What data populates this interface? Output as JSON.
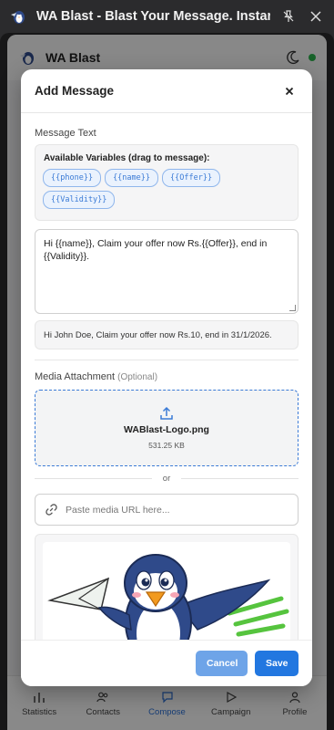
{
  "window": {
    "title": "WA Blast - Blast Your Message. Instan"
  },
  "app": {
    "name": "WA Blast",
    "status_color": "#2bb24c",
    "nav": [
      {
        "label": "Statistics",
        "icon": "bar-chart-icon"
      },
      {
        "label": "Contacts",
        "icon": "users-icon"
      },
      {
        "label": "Compose",
        "icon": "compose-icon",
        "active": true
      },
      {
        "label": "Campaign",
        "icon": "send-icon"
      },
      {
        "label": "Profile",
        "icon": "user-icon"
      }
    ]
  },
  "modal": {
    "title": "Add Message",
    "message_label": "Message Text",
    "variables_title": "Available Variables (drag to message):",
    "variables": [
      "{{phone}}",
      "{{name}}",
      "{{Offer}}",
      "{{Validity}}"
    ],
    "message_value": "Hi {{name}}, Claim your offer now Rs.{{Offer}}, end in {{Validity}}.",
    "preview_text": "Hi John Doe, Claim your offer now Rs.10, end in 31/1/2026.",
    "media_label": "Media Attachment",
    "media_optional": "(Optional)",
    "file_name": "WABlast-Logo.png",
    "file_size": "531.25 KB",
    "or_text": "or",
    "url_placeholder": "Paste media URL here...",
    "cancel_label": "Cancel",
    "save_label": "Save"
  },
  "colors": {
    "accent": "#2277e0",
    "accent_light": "#6ea4e8",
    "chip_border": "#8fb6ec"
  }
}
